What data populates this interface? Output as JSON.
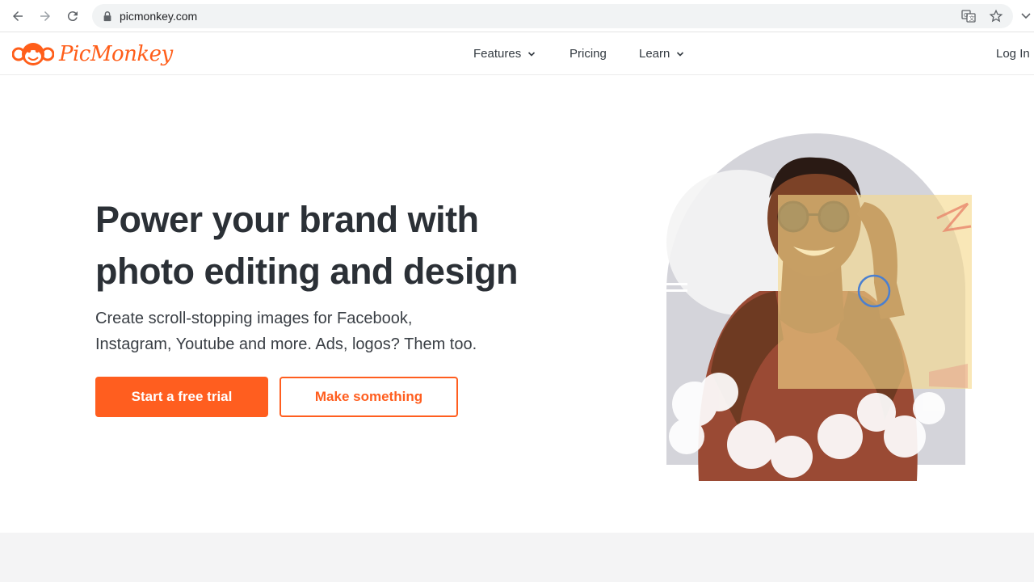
{
  "browser": {
    "url": "picmonkey.com"
  },
  "header": {
    "logo_text": "PicMonkey",
    "nav": {
      "features": "Features",
      "pricing": "Pricing",
      "learn": "Learn"
    },
    "login": "Log In"
  },
  "hero": {
    "title_line1": "Power your brand with",
    "title_line2": "photo editing and design",
    "subtitle_line1": "Create scroll-stopping images for Facebook,",
    "subtitle_line2": "Instagram, Youtube and more. Ads, logos? Them too.",
    "primary_button": "Start a free trial",
    "secondary_button": "Make something"
  },
  "colors": {
    "brand": "#ff5e1f",
    "text_dark": "#2b3036"
  }
}
